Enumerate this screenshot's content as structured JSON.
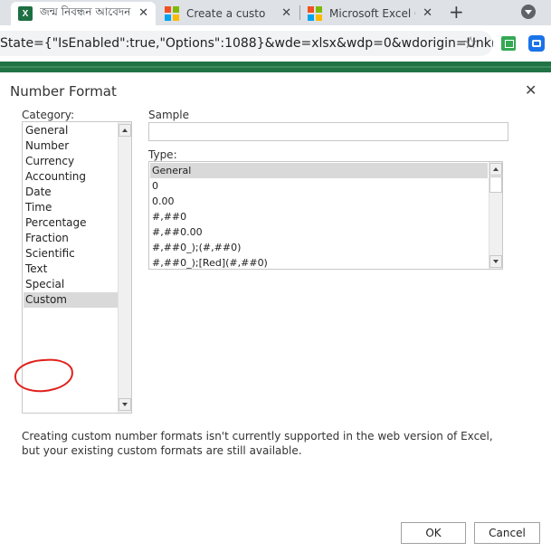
{
  "browser": {
    "tabs": [
      {
        "title": "জন্ম নিবন্ধন আবেদন",
        "icon": "excel-icon",
        "active": true
      },
      {
        "title": "Create a custom number format",
        "icon": "microsoft-icon",
        "active": false
      },
      {
        "title": "Microsoft Excel Online",
        "icon": "microsoft-icon",
        "active": false
      }
    ],
    "close_glyph": "✕",
    "new_tab_glyph": "+",
    "address": "State={\"IsEnabled\":true,\"Options\":1088}&wde=xlsx&wdp=0&wdorigin=Unkno...",
    "excel_icon_letter": "X"
  },
  "dialog": {
    "title": "Number Format",
    "close_glyph": "✕",
    "category_label": "Category:",
    "categories": [
      "General",
      "Number",
      "Currency",
      "Accounting",
      "Date",
      "Time",
      "Percentage",
      "Fraction",
      "Scientific",
      "Text",
      "Special",
      "Custom"
    ],
    "selected_category": "Custom",
    "sample_label": "Sample",
    "sample_value": "",
    "type_label": "Type:",
    "types": [
      "General",
      "0",
      "0.00",
      "#,##0",
      "#,##0.00",
      "#,##0_);(#,##0)",
      "#,##0_);[Red](#,##0)"
    ],
    "selected_type": "General",
    "info": "Creating custom number formats isn't currently supported in the web version of Excel, but your existing custom formats are still available.",
    "ok_label": "OK",
    "cancel_label": "Cancel"
  },
  "colors": {
    "excel_green": "#217346",
    "annotation_red": "#e0201b",
    "selection_gray": "#d9d9d9"
  }
}
